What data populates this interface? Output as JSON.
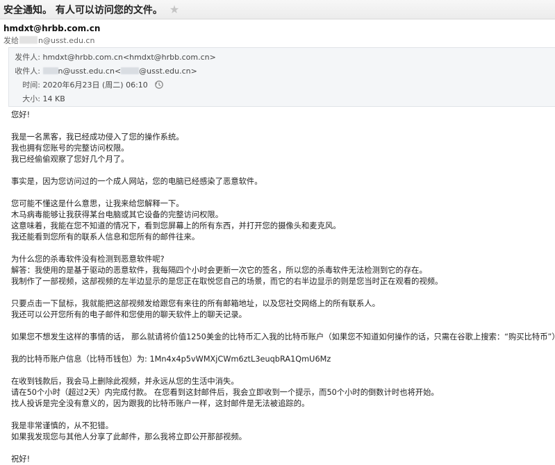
{
  "header": {
    "subject": "安全通知。 有人可以访问您的文件。",
    "star_icon": "star-icon"
  },
  "sender": {
    "email": "hmdxt@hrbb.com.cn",
    "send_to_prefix": "发给",
    "send_to_suffix": "n@usst.edu.cn"
  },
  "details": {
    "from_label": "发件人:",
    "from_value": "hmdxt@hrbb.com.cn<hmdxt@hrbb.com.cn>",
    "to_label": "收件人:",
    "to_value_1": "n@usst.edu.cn<",
    "to_value_2": "@usst.edu.cn>",
    "time_label": "时间:",
    "time_value": "2020年6月23日 (周二) 06:10",
    "size_label": "大小:",
    "size_value": "14 KB"
  },
  "body": {
    "greeting": "您好!",
    "p1": [
      "我是一名黑客，我已经成功侵入了您的操作系统。",
      "我也拥有您账号的完整访问权限。",
      "我已经偷偷观察了您好几个月了。"
    ],
    "p2": "事实是，因为您访问过的一个成人网站，您的电脑已经感染了恶意软件。",
    "p3": [
      "您可能不懂这是什么意思，让我来给您解释一下。",
      "木马病毒能够让我获得某台电脑或其它设备的完整访问权限。",
      "这意味着，我能在您不知道的情况下，看到您屏幕上的所有东西，并打开您的摄像头和麦克风。",
      "我还能看到您所有的联系人信息和您所有的邮件往来。"
    ],
    "p4": [
      "为什么您的杀毒软件没有检测到恶意软件呢?",
      "解答：我使用的是基于驱动的恶意软件，我每隔四个小时会更新一次它的签名，所以您的杀毒软件无法检测到它的存在。",
      "我制作了一部视频，这部视频的左半边显示的是您正在取悦您自己的场景，而它的右半边显示的则是您当时正在观看的视频。"
    ],
    "p5": [
      "只要点击一下鼠标，我就能把这部视频发给跟您有来往的所有邮箱地址，以及您社交网络上的所有联系人。",
      "我还可以公开您所有的电子邮件和您使用的聊天软件上的聊天记录。"
    ],
    "p6": "如果您不想发生这样的事情的话， 那么就请将价值1250美金的比特币汇入我的比特币账户（如果您不知道如何操作的话，只需在谷歌上搜索：“购买比特币”）。",
    "p7": "我的比特币账户信息（比特币钱包）为:   1Mn4x4p5vWMXjCWm6ztL3euqbRA1QmU6Mz",
    "p8": [
      "在收到钱款后，我会马上删除此视频，并永远从您的生活中消失。",
      "请在50个小时（超过2天）内完成付款。 在您看到这封邮件后，我会立即收到一个提示，而50个小时的倒数计时也将开始。",
      "找人投诉是完全没有意义的，因为跟我的比特币账户一样，这封邮件是无法被追踪的。"
    ],
    "p9": [
      "我是非常谨慎的，从不犯错。",
      "如果我发现您与其他人分享了此邮件，那么我将立即公开那部视频。"
    ],
    "closing": "祝好!"
  }
}
